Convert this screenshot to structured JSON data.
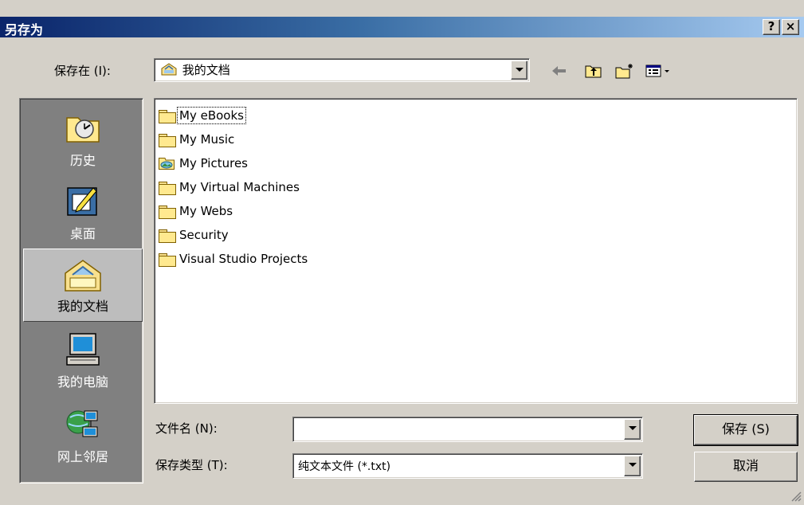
{
  "dialog": {
    "title": "另存为",
    "help": "?",
    "close": "×"
  },
  "save_in": {
    "label": "保存在 (I):",
    "value": "我的文档"
  },
  "places": [
    {
      "label": "历史",
      "icon": "history-icon"
    },
    {
      "label": "桌面",
      "icon": "desktop-icon"
    },
    {
      "label": "我的文档",
      "icon": "my-documents-icon",
      "selected": true
    },
    {
      "label": "我的电脑",
      "icon": "my-computer-icon"
    },
    {
      "label": "网上邻居",
      "icon": "network-places-icon"
    }
  ],
  "files": [
    {
      "name": "My eBooks",
      "icon": "folder-icon"
    },
    {
      "name": "My Music",
      "icon": "folder-icon"
    },
    {
      "name": "My Pictures",
      "icon": "pictures-folder-icon"
    },
    {
      "name": "My Virtual Machines",
      "icon": "folder-icon"
    },
    {
      "name": "My Webs",
      "icon": "folder-icon"
    },
    {
      "name": "Security",
      "icon": "folder-icon"
    },
    {
      "name": "Visual Studio Projects",
      "icon": "folder-icon"
    }
  ],
  "filename": {
    "label": "文件名 (N):",
    "value": ""
  },
  "filetype": {
    "label": "保存类型 (T):",
    "value": "纯文本文件 (*.txt)"
  },
  "buttons": {
    "save": "保存 (S)",
    "cancel": "取消"
  },
  "colors": {
    "title_start": "#0a246a",
    "title_end": "#a6caf0",
    "face": "#d4d0c8",
    "places_bg": "#808080"
  }
}
